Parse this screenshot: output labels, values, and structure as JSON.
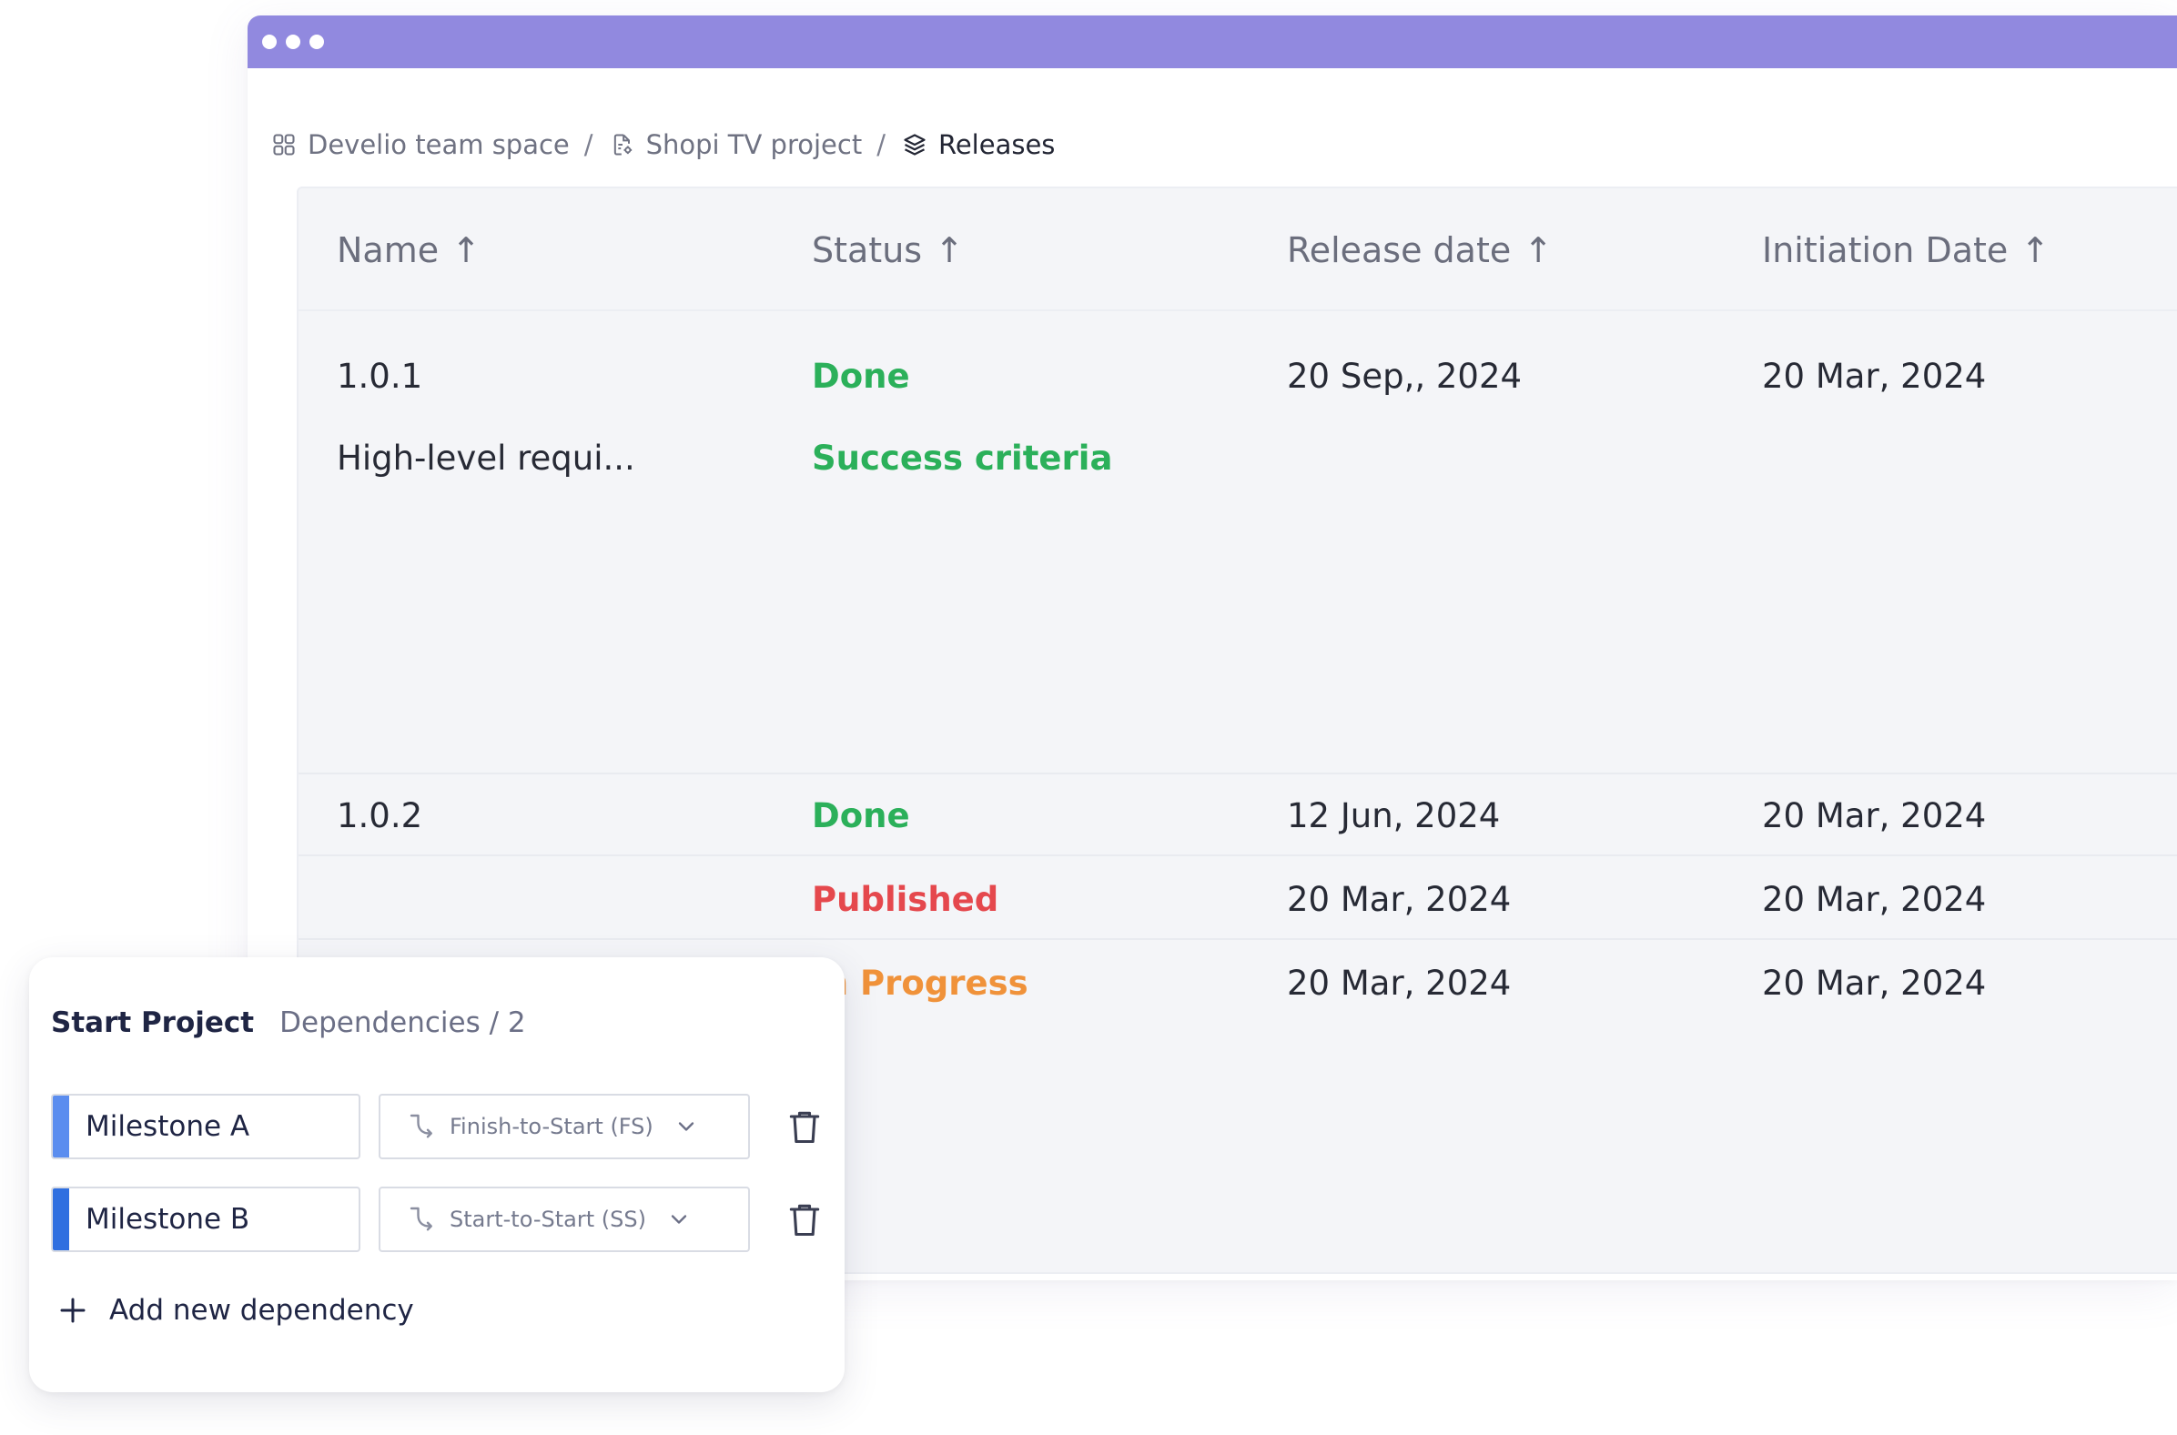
{
  "breadcrumb": {
    "space": "Develio team space",
    "project": "Shopi TV project",
    "current": "Releases",
    "separator": "/"
  },
  "table": {
    "columns": [
      "Name",
      "Status",
      "Release date",
      "Initiation Date"
    ],
    "sort_arrow": "↑",
    "rows": [
      {
        "name": "1.0.1",
        "status": "Done",
        "release_date": "20 Sep,, 2024",
        "initiation_date": "20 Mar, 2024"
      },
      {
        "name": "High-level requi...",
        "status": "Success criteria",
        "release_date": "",
        "initiation_date": ""
      },
      {
        "name": "1.0.2",
        "status": "Done",
        "release_date": "12 Jun, 2024",
        "initiation_date": "20 Mar, 2024"
      },
      {
        "name": "",
        "status": "Published",
        "release_date": "20 Mar, 2024",
        "initiation_date": "20 Mar, 2024"
      },
      {
        "name": "",
        "status": "In Progress",
        "release_date": "20 Mar, 2024",
        "initiation_date": "20 Mar, 2024"
      }
    ]
  },
  "dependencies": {
    "title": "Start Project",
    "subtitle": "Dependencies / 2",
    "items": [
      {
        "name": "Milestone A",
        "type": "Finish-to-Start (FS)",
        "color": "#5b8def"
      },
      {
        "name": "Milestone B",
        "type": "Start-to-Start (SS)",
        "color": "#2f6fe0"
      }
    ],
    "add_label": "Add new dependency"
  },
  "colors": {
    "titlebar": "#9189df",
    "status_done": "#2bb05a",
    "status_published": "#e5484d",
    "status_in_progress": "#f0923a"
  }
}
